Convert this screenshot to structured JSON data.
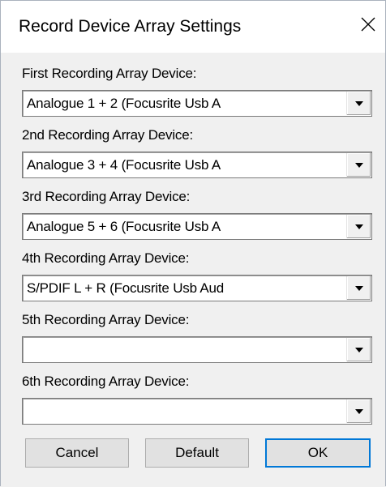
{
  "window": {
    "title": "Record Device Array Settings",
    "close_icon": "close-x-icon"
  },
  "devices": [
    {
      "label": "First Recording Array Device:",
      "value": "Analogue 1 + 2 (Focusrite Usb A"
    },
    {
      "label": "2nd Recording Array Device:",
      "value": "Analogue 3 + 4 (Focusrite Usb A"
    },
    {
      "label": "3rd Recording Array Device:",
      "value": "Analogue 5 + 6 (Focusrite Usb A"
    },
    {
      "label": "4th Recording Array Device:",
      "value": "S/PDIF L + R (Focusrite Usb Aud"
    },
    {
      "label": "5th Recording Array Device:",
      "value": ""
    },
    {
      "label": "6th Recording Array Device:",
      "value": ""
    }
  ],
  "buttons": {
    "cancel": "Cancel",
    "default": "Default",
    "ok": "OK"
  },
  "colors": {
    "accent": "#0078d7",
    "background": "#f0f0f0"
  }
}
